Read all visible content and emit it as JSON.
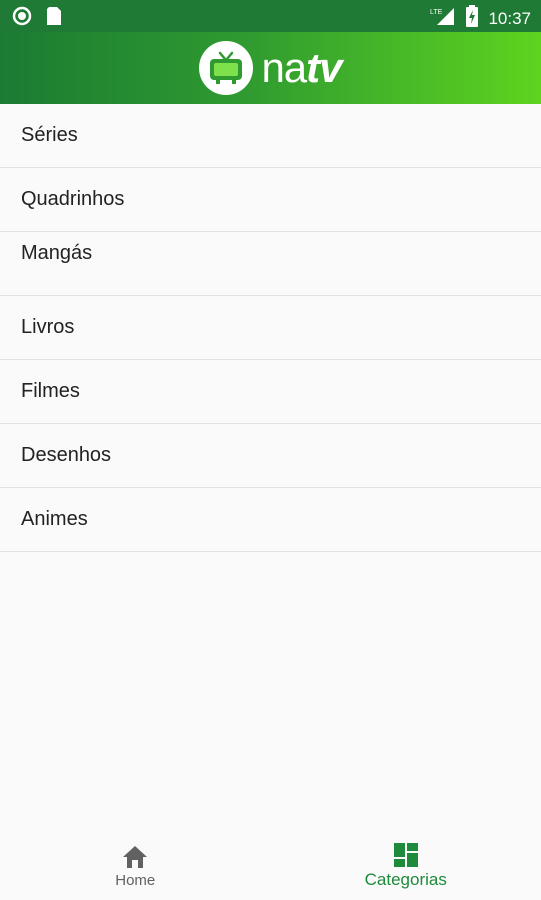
{
  "status_bar": {
    "time": "10:37",
    "signal_label": "LTE",
    "icons": [
      "notification-dot-icon",
      "sim-card-icon",
      "lte-signal-icon",
      "battery-charging-icon"
    ]
  },
  "app_bar": {
    "logo_text_a": "na",
    "logo_text_b": "tv",
    "logo_icon": "tv-icon"
  },
  "categories": [
    {
      "label": "Séries"
    },
    {
      "label": "Quadrinhos"
    },
    {
      "label": "Mangás"
    },
    {
      "label": "Livros"
    },
    {
      "label": "Filmes"
    },
    {
      "label": "Desenhos"
    },
    {
      "label": "Animes"
    }
  ],
  "bottom_nav": {
    "items": [
      {
        "label": "Home",
        "icon": "home-icon",
        "active": false
      },
      {
        "label": "Categorias",
        "icon": "dashboard-icon",
        "active": true
      }
    ]
  },
  "colors": {
    "primary_dark": "#1e7a34",
    "primary_light": "#5ed41f",
    "active_tab": "#1e8a3c"
  }
}
